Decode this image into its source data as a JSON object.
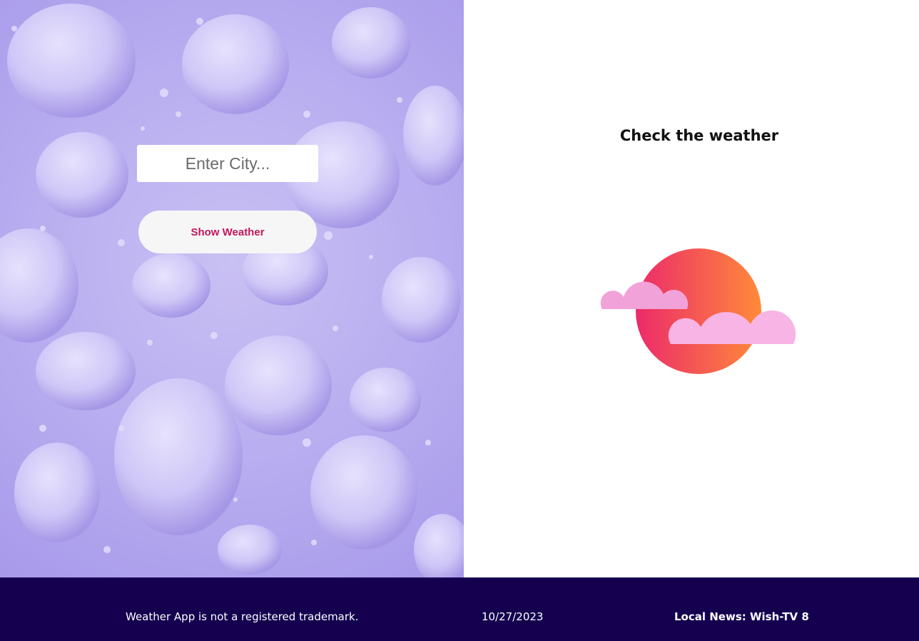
{
  "search": {
    "placeholder": "Enter City..."
  },
  "actions": {
    "show_weather_label": "Show Weather"
  },
  "main": {
    "title": "Check the weather"
  },
  "footer": {
    "disclaimer": "Weather App is not a registered trademark.",
    "date": "10/27/2023",
    "news": "Local News: Wish-TV 8"
  },
  "colors": {
    "left_background": "#b8aef0",
    "button_text": "#c2185b",
    "footer_background": "#14004f",
    "sun_gradient_start": "#ec2a6a",
    "sun_gradient_end": "#ff8a3a",
    "cloud": "#f8b4e4"
  },
  "icons": {
    "background": "water-drops-background",
    "illustration": "sun-with-clouds-icon"
  }
}
